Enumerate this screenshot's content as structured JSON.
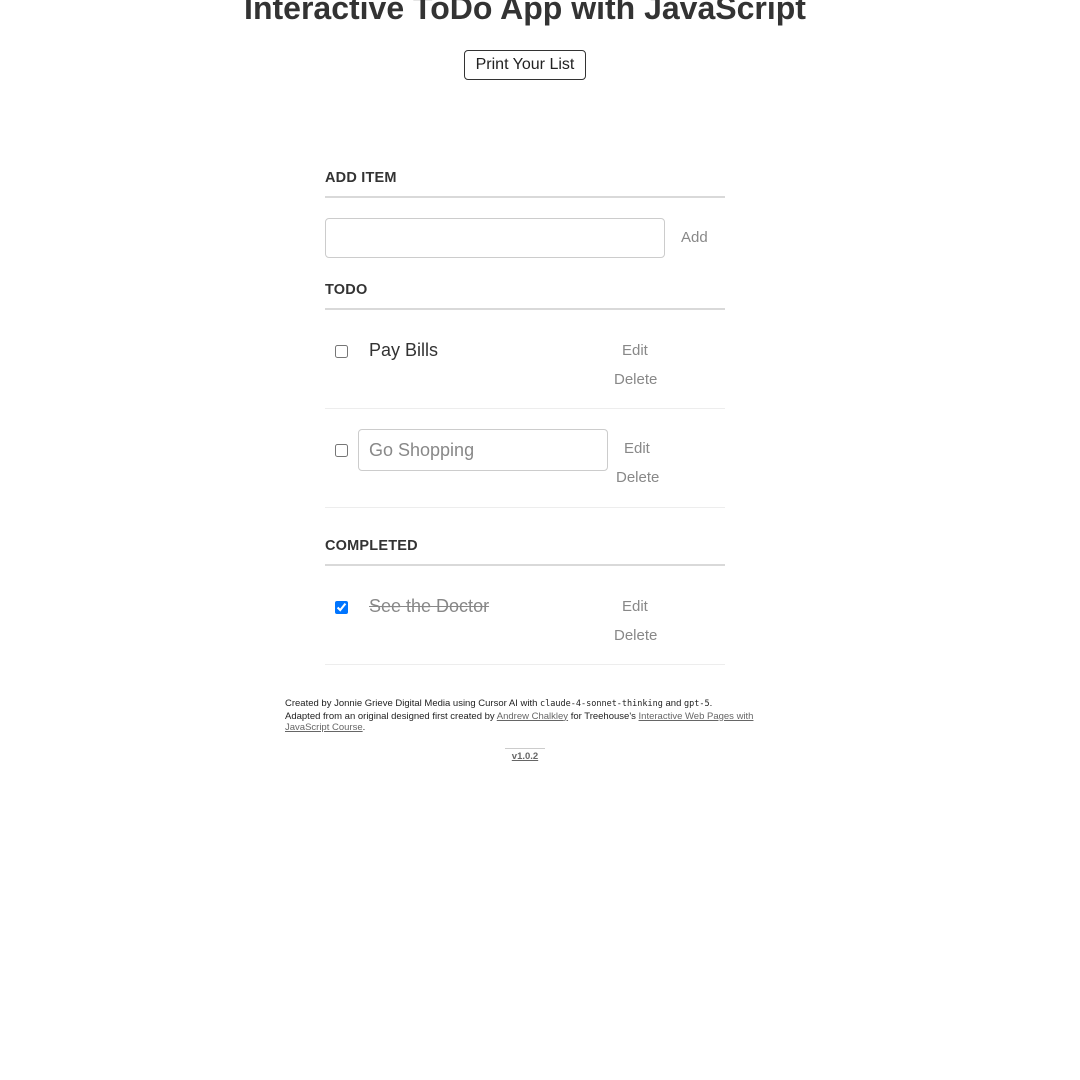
{
  "header": {
    "title": "Interactive ToDo App with JavaScript",
    "print_label": "Print Your List"
  },
  "add_item": {
    "heading": "ADD ITEM",
    "input_value": "",
    "add_label": "Add"
  },
  "todo": {
    "heading": "TODO",
    "items": [
      {
        "text": "Pay Bills",
        "checked": false,
        "editing": false,
        "edit_label": "Edit",
        "delete_label": "Delete"
      },
      {
        "text": "Go Shopping",
        "checked": false,
        "editing": true,
        "edit_label": "Edit",
        "delete_label": "Delete"
      }
    ]
  },
  "completed": {
    "heading": "COMPLETED",
    "items": [
      {
        "text": "See the Doctor",
        "checked": true,
        "editing": false,
        "edit_label": "Edit",
        "delete_label": "Delete"
      }
    ]
  },
  "footer": {
    "line1_prefix": "Created by Jonnie Grieve Digital Media using Cursor AI with ",
    "model1": "claude-4-sonnet-thinking",
    "line1_and": " and ",
    "model2": "gpt-5",
    "line1_end": ".",
    "line2_prefix": "Adapted from an original designed first created by ",
    "author_link": "Andrew Chalkley",
    "line2_mid": " for Treehouse's ",
    "course_link": "Interactive Web Pages with JavaScript Course",
    "line2_end": "."
  },
  "version": "v1.0.2",
  "colors": {
    "accent_checkbox": "#0075ff",
    "muted_text": "#888888",
    "divider": "#d9d9d9"
  }
}
